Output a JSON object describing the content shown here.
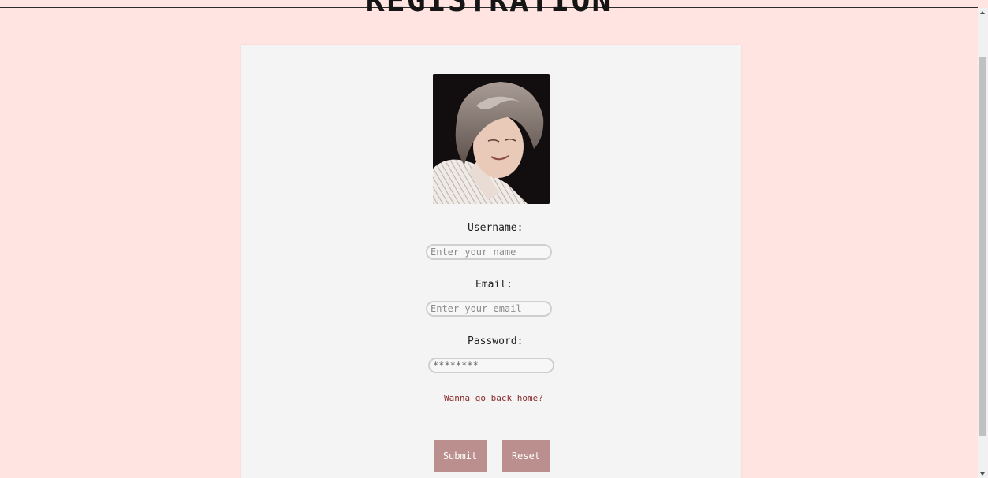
{
  "page": {
    "title": "REGISTRATION",
    "background": "#ffe4e1",
    "card_background": "#f4f4f4",
    "accent": "#bc8f8f",
    "link_color": "#8b2b2b"
  },
  "form": {
    "username_label": "Username:",
    "username_placeholder": "Enter your name",
    "email_label": "Email:",
    "email_placeholder": "Enter your email",
    "password_label": "Password:",
    "password_value": "********",
    "home_link": "Wanna go back home?",
    "submit_label": "Submit",
    "reset_label": "Reset"
  },
  "profile_photo": {
    "description_icon": "profile-photo"
  }
}
